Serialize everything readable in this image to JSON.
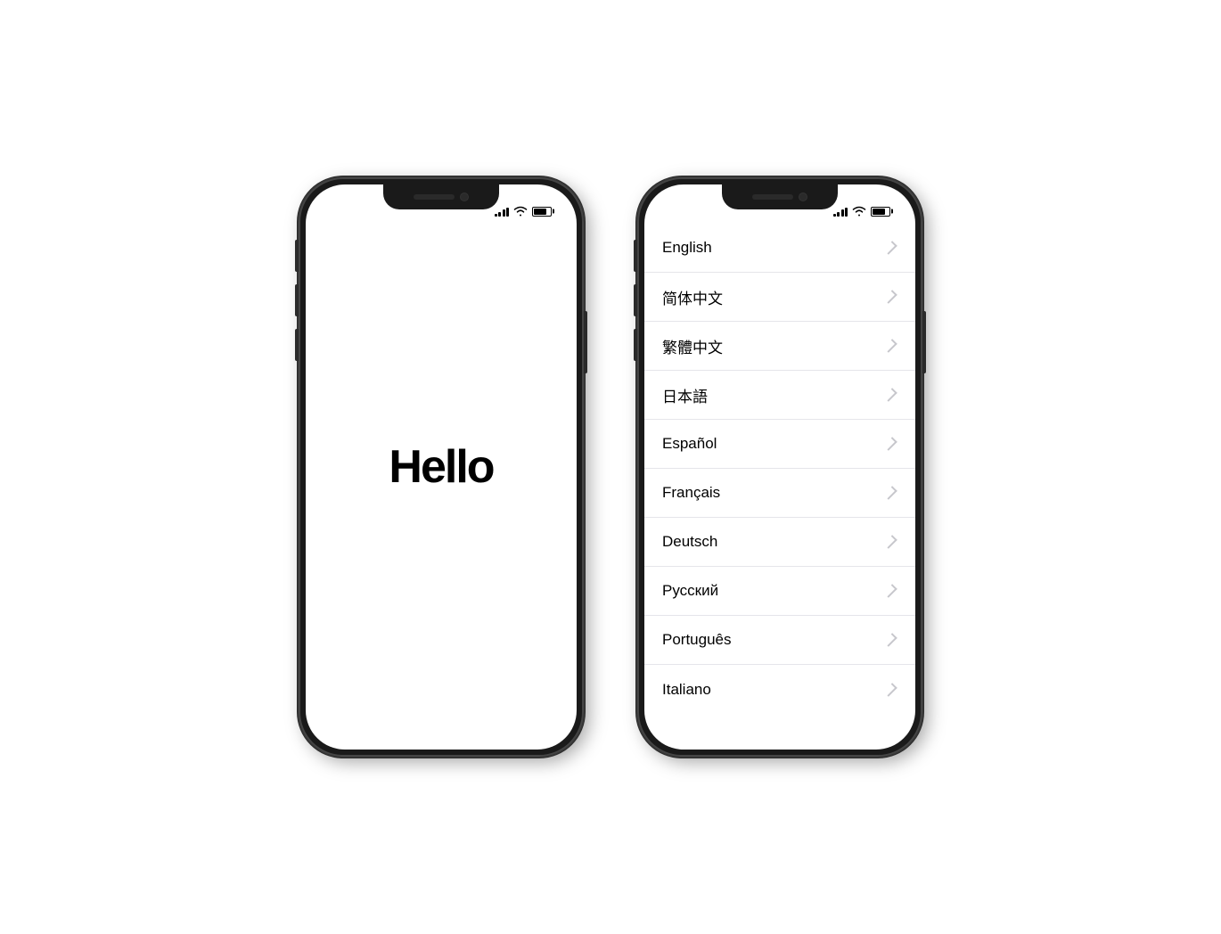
{
  "phone1": {
    "hello_text": "Hello",
    "status": {
      "signal": [
        3,
        5,
        8,
        10,
        12
      ],
      "battery_label": "battery"
    }
  },
  "phone2": {
    "languages": [
      {
        "name": "English"
      },
      {
        "name": "简体中文"
      },
      {
        "name": "繁體中文"
      },
      {
        "name": "日本語"
      },
      {
        "name": "Español"
      },
      {
        "name": "Français"
      },
      {
        "name": "Deutsch"
      },
      {
        "name": "Русский"
      },
      {
        "name": "Português"
      },
      {
        "name": "Italiano"
      }
    ]
  }
}
